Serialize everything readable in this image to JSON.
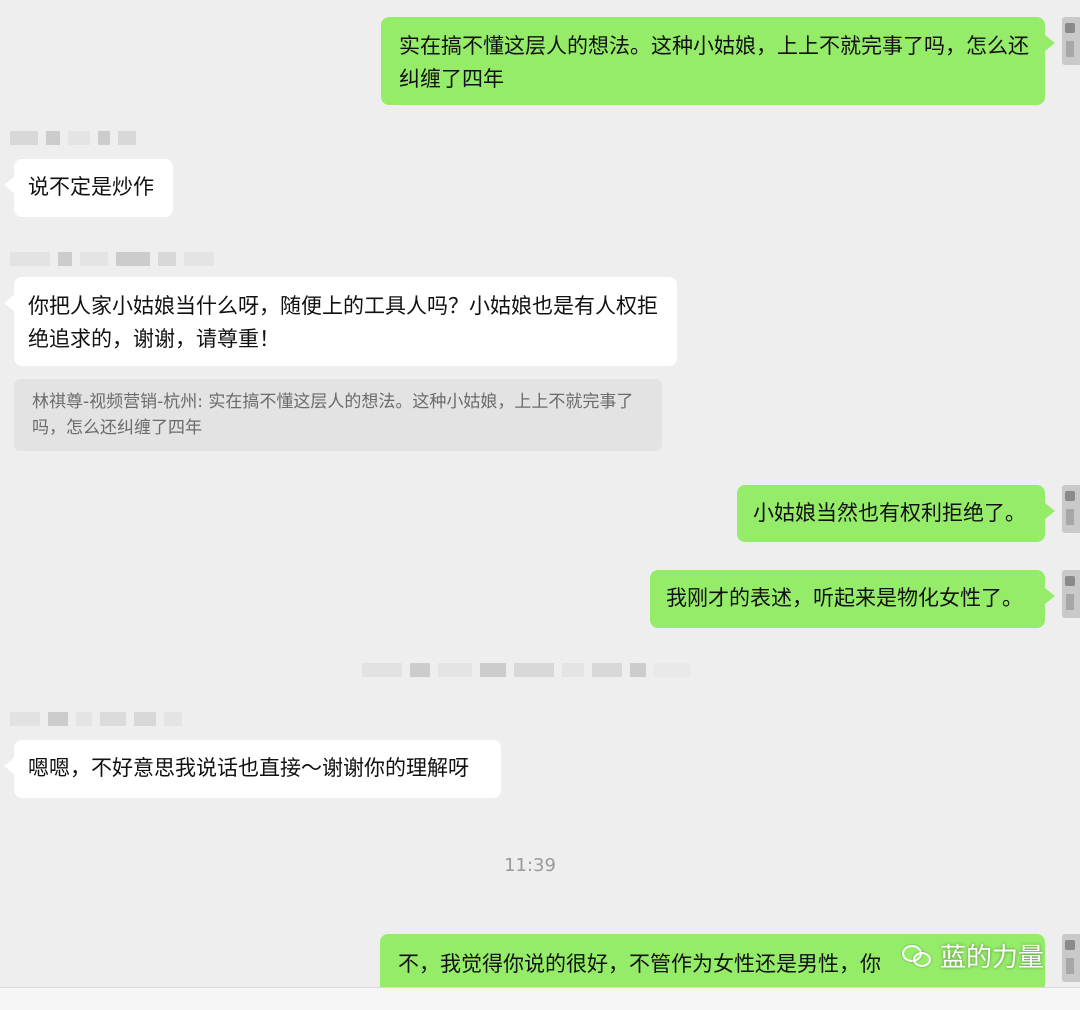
{
  "messages": {
    "m1": {
      "text": "实在搞不懂这层人的想法。这种小姑娘，上上不就完事了吗，怎么还纠缠了四年"
    },
    "m2": {
      "text": "说不定是炒作"
    },
    "m3": {
      "text": "你把人家小姑娘当什么呀，随便上的工具人吗？小姑娘也是有人权拒绝追求的，谢谢，请尊重！"
    },
    "m3_quote": {
      "text": "林祺尊-视频营销-杭州: 实在搞不懂这层人的想法。这种小姑娘，上上不就完事了吗，怎么还纠缠了四年"
    },
    "m4": {
      "text": "小姑娘当然也有权利拒绝了。"
    },
    "m5": {
      "text": "我刚才的表述，听起来是物化女性了。"
    },
    "m6": {
      "text": "嗯嗯，不好意思我说话也直接～谢谢你的理解呀"
    },
    "m7": {
      "text": "不，我觉得你说的很好，不管作为女性还是男性，你"
    }
  },
  "timestamp": "11:39",
  "watermark": {
    "text": "蓝的力量",
    "icon": "wechat-icon"
  },
  "colors": {
    "outgoing": "#95ec69",
    "incoming": "#ffffff",
    "background": "#eeeeee",
    "quote": "#e3e3e3"
  }
}
